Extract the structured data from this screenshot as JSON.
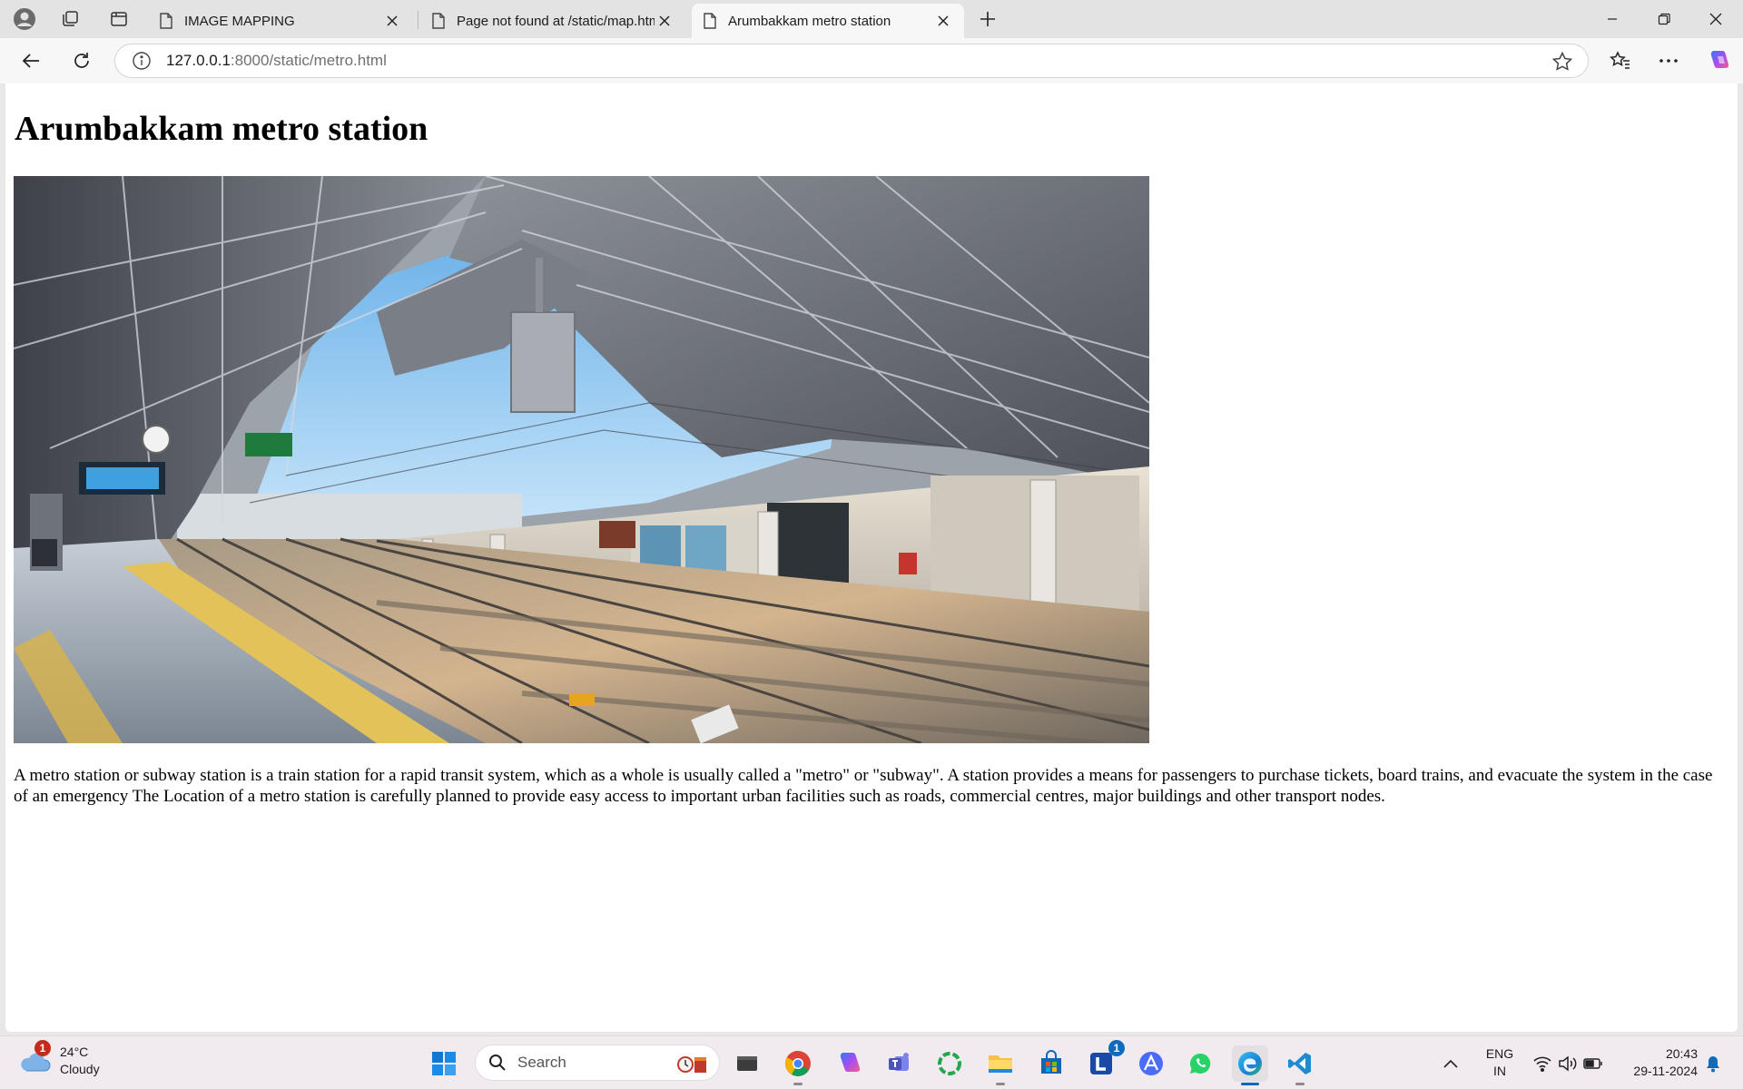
{
  "browser": {
    "tabs": [
      {
        "title": "IMAGE MAPPING",
        "active": false
      },
      {
        "title": "Page not found at /static/map.htm",
        "active": false
      },
      {
        "title": "Arumbakkam metro station",
        "active": true
      }
    ],
    "address": {
      "host": "127.0.0.1",
      "rest": ":8000/static/metro.html"
    }
  },
  "page": {
    "heading": "Arumbakkam metro station",
    "image_alt": "Arumbakkam metro station platform",
    "paragraph": "A metro station or subway station is a train station for a rapid transit system, which as a whole is usually called a \"metro\" or \"subway\". A station provides a means for passengers to purchase tickets, board trains, and evacuate the system in the case of an emergency The Location of a metro station is carefully planned to provide easy access to important urban facilities such as roads, commercial centres, major buildings and other transport nodes."
  },
  "taskbar": {
    "weather": {
      "temp": "24°C",
      "condition": "Cloudy",
      "badge": "1"
    },
    "search_placeholder": "Search",
    "apps": [
      "start-icon",
      "file-explorer-dark-icon",
      "chrome-icon",
      "copilot-icon",
      "teams-icon",
      "circle-app-icon",
      "file-explorer-icon",
      "store-icon",
      "l-app-icon",
      "vector-app-icon",
      "whatsapp-icon",
      "edge-icon",
      "vscode-icon"
    ],
    "l_app_badge": "1",
    "language": {
      "line1": "ENG",
      "line2": "IN"
    },
    "time": "20:43",
    "date": "29-11-2024"
  },
  "colors": {
    "accent": "#0067c0",
    "sky": "#6cb3e8",
    "roof": "#6a6e78"
  }
}
